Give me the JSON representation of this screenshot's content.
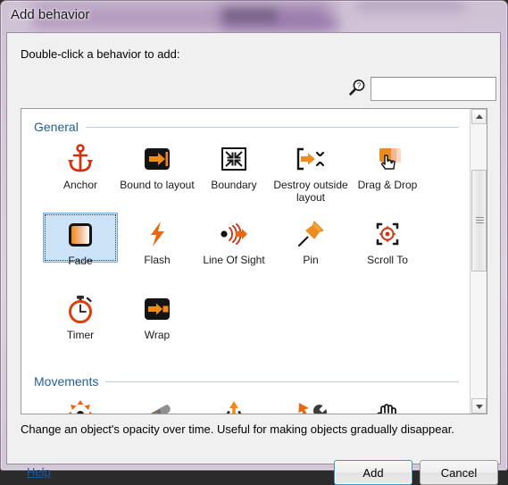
{
  "window": {
    "title": "Add behavior"
  },
  "dialog": {
    "prompt": "Double-click a behavior to add:",
    "search": {
      "icon": "search-magnifier-icon",
      "value": "",
      "placeholder": ""
    },
    "description": "Change an object's opacity over time.  Useful for making objects gradually disappear."
  },
  "groups": [
    {
      "title": "General",
      "items": [
        {
          "label": "Anchor",
          "icon": "anchor-icon"
        },
        {
          "label": "Bound to layout",
          "icon": "bound-to-layout-icon"
        },
        {
          "label": "Boundary",
          "icon": "boundary-icon"
        },
        {
          "label": "Destroy outside layout",
          "icon": "destroy-outside-layout-icon"
        },
        {
          "label": "Drag & Drop",
          "icon": "drag-and-drop-icon"
        },
        {
          "label": "Fade",
          "icon": "fade-icon",
          "selected": true
        },
        {
          "label": "Flash",
          "icon": "flash-icon"
        },
        {
          "label": "Line Of Sight",
          "icon": "line-of-sight-icon"
        },
        {
          "label": "Pin",
          "icon": "pin-icon"
        },
        {
          "label": "Scroll To",
          "icon": "scroll-to-icon"
        },
        {
          "label": "Timer",
          "icon": "timer-icon"
        },
        {
          "label": "Wrap",
          "icon": "wrap-icon"
        }
      ]
    },
    {
      "title": "Movements",
      "items": [
        {
          "label": "",
          "icon": "eight-direction-icon"
        },
        {
          "label": "",
          "icon": "bullet-icon"
        },
        {
          "label": "",
          "icon": "bounce-icon"
        },
        {
          "label": "",
          "icon": "custom-movement-icon"
        },
        {
          "label": "",
          "icon": "drag-hand-icon"
        }
      ]
    }
  ],
  "footer": {
    "help_label": "Help",
    "add_label": "Add",
    "cancel_label": "Cancel"
  },
  "scrollbar": {
    "up_icon": "scroll-up-arrow-icon",
    "down_icon": "scroll-down-arrow-icon"
  },
  "colors": {
    "accent_orange": "#e8791a",
    "accent_red": "#cc2b13",
    "group_header_blue": "#21619e",
    "selection_blue": "#cde3f7",
    "link_blue": "#1858a8",
    "glass_lavender": "#d6cbda"
  }
}
